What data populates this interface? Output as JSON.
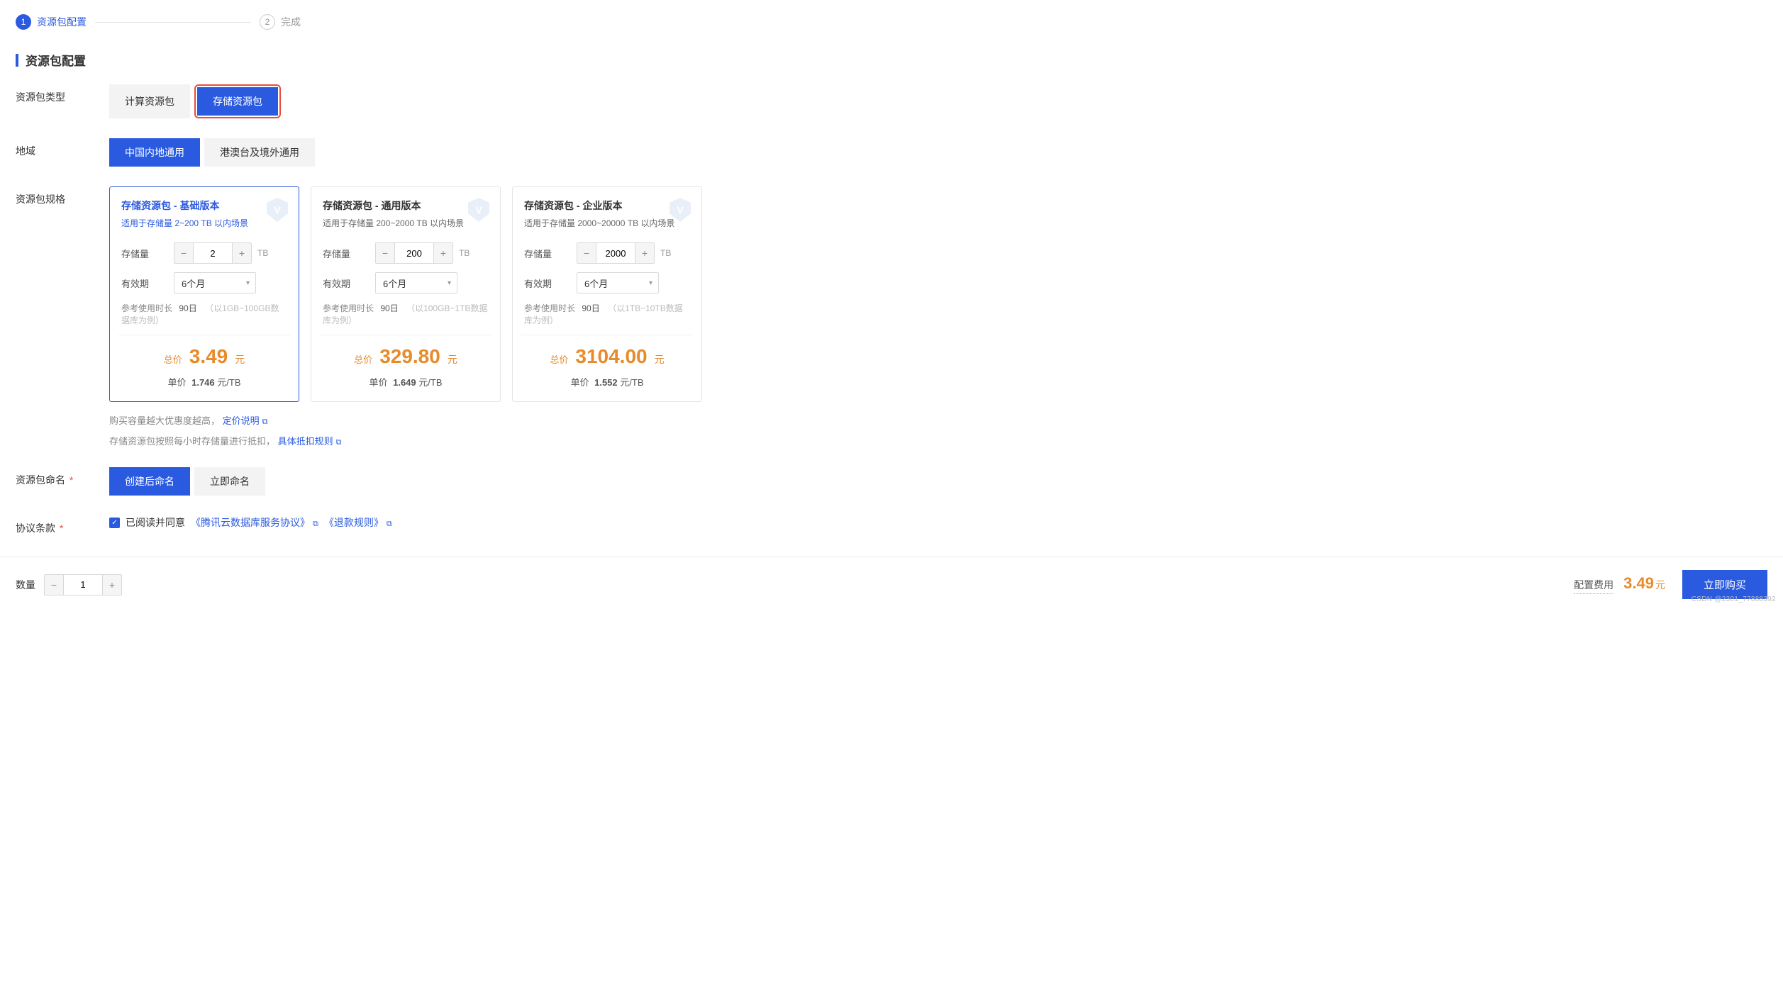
{
  "steps": {
    "step1_num": "1",
    "step1_label": "资源包配置",
    "step2_num": "2",
    "step2_label": "完成"
  },
  "section_title": "资源包配置",
  "type_row": {
    "label": "资源包类型",
    "opt_compute": "计算资源包",
    "opt_storage": "存储资源包"
  },
  "region_row": {
    "label": "地域",
    "opt_mainland": "中国内地通用",
    "opt_overseas": "港澳台及境外通用"
  },
  "spec_row": {
    "label": "资源包规格"
  },
  "cards": {
    "storage_label": "存储量",
    "storage_unit": "TB",
    "period_label": "有效期",
    "ref_label": "参考使用时长",
    "total_label": "总价",
    "total_unit": "元",
    "unit_label": "单价",
    "unit_suffix": "元/TB",
    "list": [
      {
        "title": "存储资源包 - 基础版本",
        "sub": "适用于存储量 2~200 TB 以内场景",
        "storage_value": "2",
        "period_value": "6个月",
        "ref_value": "90日",
        "ref_hint": "（以1GB~100GB数据库为例）",
        "total": "3.49",
        "unit_price": "1.746"
      },
      {
        "title": "存储资源包 - 通用版本",
        "sub": "适用于存储量 200~2000 TB 以内场景",
        "storage_value": "200",
        "period_value": "6个月",
        "ref_value": "90日",
        "ref_hint": "（以100GB~1TB数据库为例）",
        "total": "329.80",
        "unit_price": "1.649"
      },
      {
        "title": "存储资源包 - 企业版本",
        "sub": "适用于存储量 2000~20000 TB 以内场景",
        "storage_value": "2000",
        "period_value": "6个月",
        "ref_value": "90日",
        "ref_hint": "（以1TB~10TB数据库为例）",
        "total": "3104.00",
        "unit_price": "1.552"
      }
    ]
  },
  "hints": {
    "line1_text": "购买容量越大优惠度越高，",
    "line1_link": "定价说明",
    "line2_text": "存储资源包按照每小时存储量进行抵扣，",
    "line2_link": "具体抵扣规则"
  },
  "naming_row": {
    "label": "资源包命名",
    "opt_after": "创建后命名",
    "opt_now": "立即命名"
  },
  "terms_row": {
    "label": "协议条款",
    "agree_text": "已阅读并同意",
    "link1": "《腾讯云数据库服务协议》",
    "link2": "《退款规则》"
  },
  "footer": {
    "qty_label": "数量",
    "qty_value": "1",
    "cost_label": "配置费用",
    "cost_value": "3.49",
    "cost_unit": "元",
    "buy_label": "立即购买",
    "watermark": "CSDN @2301_77888392"
  }
}
